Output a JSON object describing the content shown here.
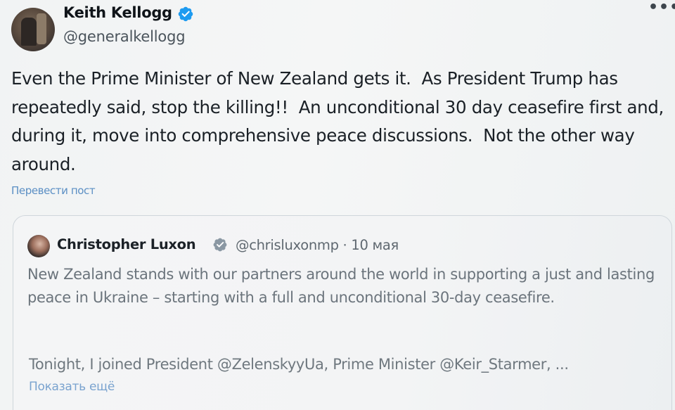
{
  "author": {
    "display_name": "Keith Kellogg",
    "handle": "@generalkellogg",
    "verified_icon": "verified-badge-icon"
  },
  "menu": {
    "more_label": "•••"
  },
  "tweet": {
    "text": "Even the Prime Minister of New Zealand gets it.  As President Trump has repeatedly said, stop the killing!!  An unconditional 30 day ceasefire first and, during it, move into comprehensive peace discussions.  Not the other way around.",
    "translate_label": "Перевести пост"
  },
  "quote": {
    "display_name": "Christopher Luxon",
    "handle_date": "@chrisluxonmp · 10 мая",
    "text": "New Zealand stands with our partners around the world in supporting a just and lasting peace in Ukraine – starting with a full and unconditional 30-day ceasefire.",
    "text_continued": "Tonight, I joined President @ZelenskyyUa, Prime Minister @Keir_Starmer, ...",
    "show_more_label": "Показать ещё"
  },
  "colors": {
    "verified_blue": "#1d9bf0",
    "link_blue": "#5b8fc4",
    "text_dark": "#1a2026",
    "text_muted": "#6b747c"
  }
}
